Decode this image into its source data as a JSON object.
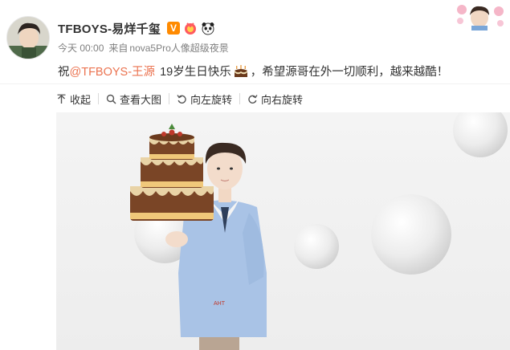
{
  "post": {
    "author": "TFBOYS-易烊千玺",
    "verified_mark": "V",
    "timestamp": "今天 00:00",
    "source_prefix": "来自",
    "source": "nova5Pro人像超级夜景",
    "text_before": "祝",
    "mention": "@TFBOYS-王源",
    "text_middle": "19岁生日快乐",
    "text_after": "，希望源哥在外一切顺利，越来越酷！",
    "colors": {
      "mention": "#eb7350",
      "verified": "#ff8a00",
      "meta": "#808080"
    }
  },
  "toolbar": {
    "collapse_label": "收起",
    "view_large_label": "查看大图",
    "rotate_left_label": "向左旋转",
    "rotate_right_label": "向右旋转"
  },
  "image": {
    "tshirt_text": "AHT"
  },
  "icons": [
    "avatar",
    "verified-icon",
    "red-badge-icon",
    "panda-icon",
    "cake-emoji-icon",
    "arrow-up-icon",
    "magnifier-icon",
    "rotate-left-icon",
    "rotate-right-icon"
  ]
}
